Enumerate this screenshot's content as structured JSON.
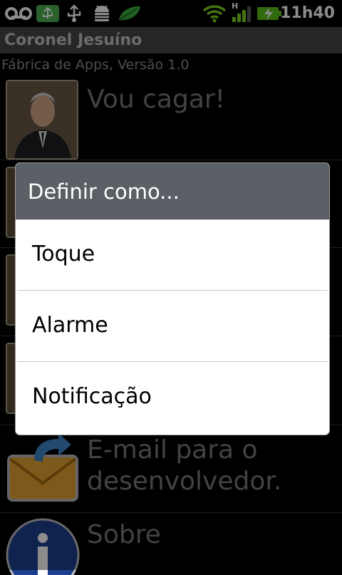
{
  "status_bar": {
    "time": "11h40",
    "network_type": "H",
    "icons": [
      "voicemail-icon",
      "usb-debug-icon",
      "usb-icon",
      "android-debug-icon",
      "leaf-icon",
      "wifi-icon",
      "signal-icon",
      "battery-charging-icon"
    ]
  },
  "app": {
    "title": "Coronel Jesuíno",
    "subtitle": "Fábrica de Apps, Versão 1.0"
  },
  "list": [
    {
      "label": "Vou cagar!"
    },
    {
      "label": "E-mail para o desenvolvedor."
    },
    {
      "label": "Sobre"
    }
  ],
  "dialog": {
    "title": "Definir como...",
    "options": [
      "Toque",
      "Alarme",
      "Notificação"
    ]
  },
  "colors": {
    "title_bar": "#464646",
    "dialog_header": "#5b5f66",
    "battery_green": "#5cc11d"
  }
}
